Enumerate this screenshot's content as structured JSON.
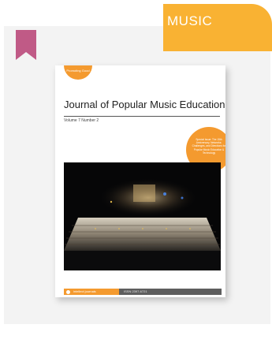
{
  "category": {
    "label": "MUSIC"
  },
  "bookmark": {
    "icon": "bookmark-icon",
    "color": "#c05a86"
  },
  "cover": {
    "badge_text": "Promoting Good",
    "journal_title": "Journal of Popular Music Education",
    "issue": "Volume 7 Number 2",
    "promo_text": "Special Issue: The 15th Anniversary, Networks: Challenges, and Directions for Popular Music Education & Technology",
    "publisher": "intellect journals",
    "issn": "ISSN 2397-6721"
  },
  "colors": {
    "accent": "#f9b233",
    "cover_orange": "#f49a2f",
    "card_bg": "#f3f3f3"
  }
}
